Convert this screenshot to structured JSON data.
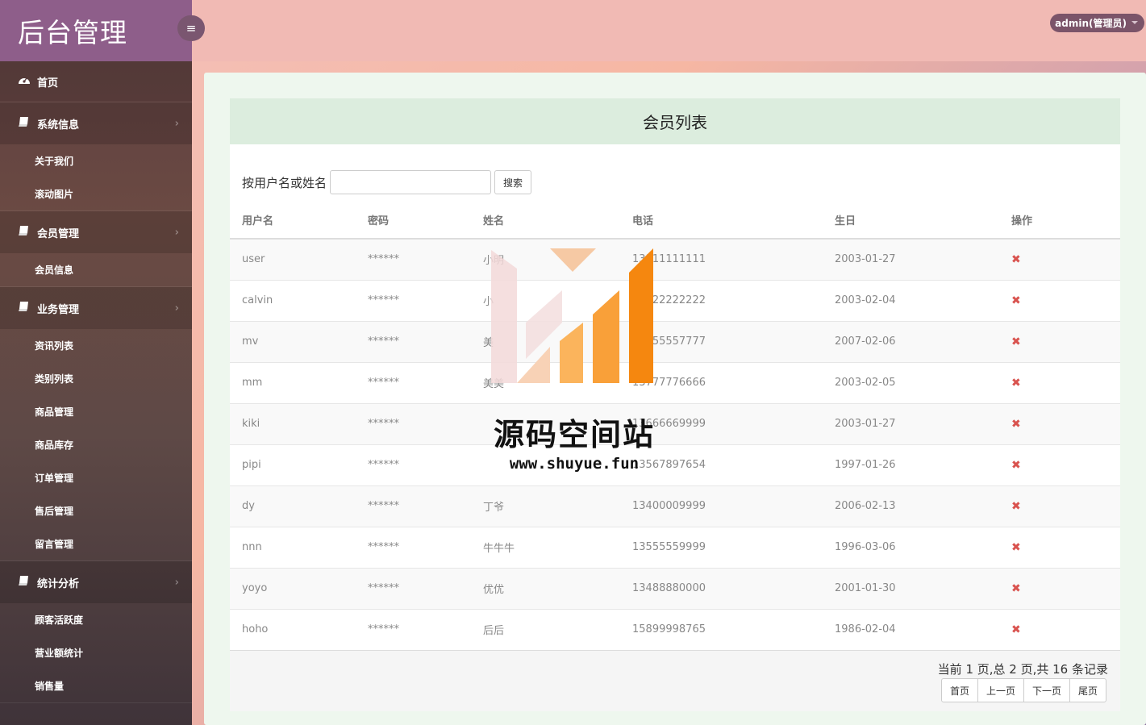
{
  "brand": {
    "title": "后台管理"
  },
  "header": {
    "user": "admin(管理员)"
  },
  "sidebar": {
    "home": "首页",
    "groups": [
      {
        "label": "系统信息",
        "items": [
          "关于我们",
          "滚动图片"
        ]
      },
      {
        "label": "会员管理",
        "items": [
          "会员信息"
        ]
      },
      {
        "label": "业务管理",
        "items": [
          "资讯列表",
          "类别列表",
          "商品管理",
          "商品库存",
          "订单管理",
          "售后管理",
          "留言管理"
        ]
      },
      {
        "label": "统计分析",
        "items": [
          "顾客活跃度",
          "营业额统计",
          "销售量"
        ]
      }
    ]
  },
  "main": {
    "title": "会员列表",
    "search": {
      "label": "按用户名或姓名",
      "value": "",
      "button": "搜索"
    },
    "columns": [
      "用户名",
      "密码",
      "姓名",
      "电话",
      "生日",
      "操作"
    ],
    "rows": [
      [
        "user",
        "******",
        "小明",
        "13111111111",
        "2003-01-27"
      ],
      [
        "calvin",
        "******",
        "小",
        "13222222222",
        "2003-02-04"
      ],
      [
        "mv",
        "******",
        "美",
        "13555557777",
        "2007-02-06"
      ],
      [
        "mm",
        "******",
        "美美",
        "13777776666",
        "2003-02-05"
      ],
      [
        "kiki",
        "******",
        "",
        "13666669999",
        "2003-01-27"
      ],
      [
        "pipi",
        "******",
        "",
        "13567897654",
        "1997-01-26"
      ],
      [
        "dy",
        "******",
        "丁爷",
        "13400009999",
        "2006-02-13"
      ],
      [
        "nnn",
        "******",
        "牛牛牛",
        "13555559999",
        "1996-03-06"
      ],
      [
        "yoyo",
        "******",
        "优优",
        "13488880000",
        "2001-01-30"
      ],
      [
        "hoho",
        "******",
        "后后",
        "15899998765",
        "1986-02-04"
      ]
    ],
    "delete_icon": "✖",
    "pager": {
      "info": "当前 1 页,总 2 页,共 16 条记录",
      "buttons": [
        "首页",
        "上一页",
        "下一页",
        "尾页"
      ]
    }
  },
  "watermark": {
    "text": "源码空间站",
    "url": "www.shuyue.fun"
  },
  "colors": {
    "brand_bg": "#8e5e8a",
    "header_bg": "#f1bab4",
    "title_bar": "#dcedde",
    "delete": "#d9534f"
  }
}
